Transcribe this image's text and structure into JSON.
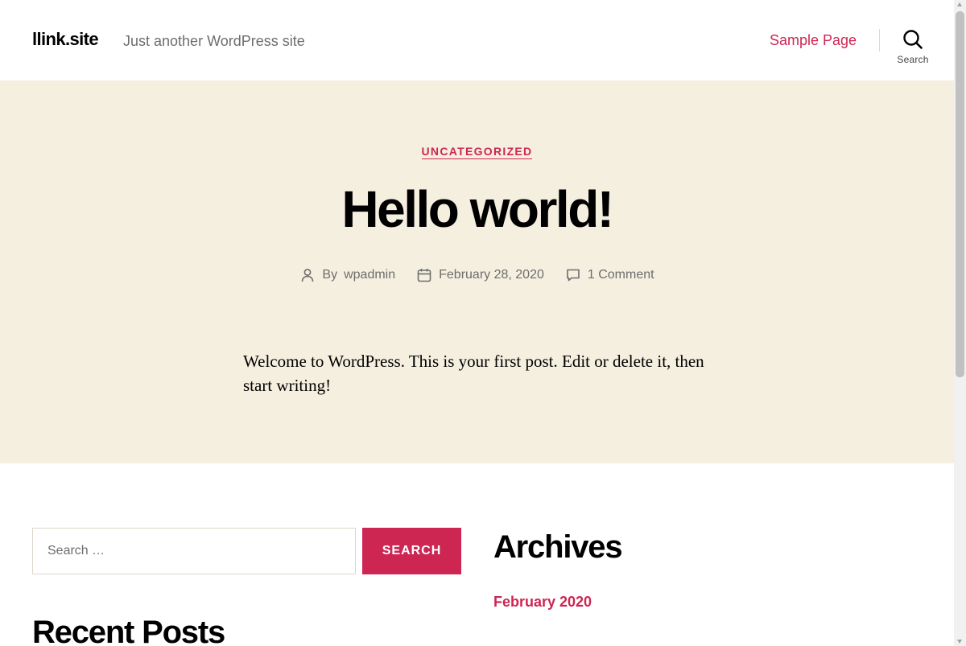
{
  "header": {
    "site_title": "llink.site",
    "site_description": "Just another WordPress site",
    "nav_items": [
      {
        "label": "Sample Page"
      }
    ],
    "search_label": "Search"
  },
  "post": {
    "category": "UNCATEGORIZED",
    "title": "Hello world!",
    "author_prefix": "By",
    "author": "wpadmin",
    "date": "February 28, 2020",
    "comments": "1 Comment",
    "content": "Welcome to WordPress. This is your first post. Edit or delete it, then start writing!"
  },
  "widgets": {
    "search": {
      "placeholder": "Search …",
      "value": "",
      "button_label": "SEARCH"
    },
    "recent_posts_title": "Recent Posts",
    "archives": {
      "title": "Archives",
      "items": [
        {
          "label": "February 2020"
        }
      ]
    }
  },
  "colors": {
    "accent": "#cd2653",
    "hero_background": "#f5efe0",
    "muted_text": "#6d6d6d",
    "border": "#dcd7ca"
  },
  "icons": {
    "search_toggle": "search-icon",
    "author": "user-icon",
    "date": "calendar-icon",
    "comments": "comment-icon"
  }
}
